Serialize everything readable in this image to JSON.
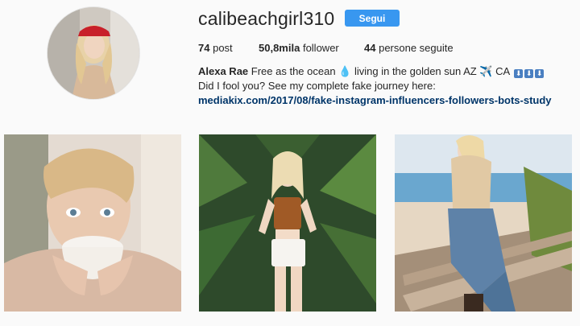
{
  "profile": {
    "username": "calibeachgirl310",
    "follow_label": "Segui",
    "avatar_icon": "profile-photo",
    "stats": {
      "posts_value": "74",
      "posts_label": "post",
      "followers_value": "50,8mila",
      "followers_label": "follower",
      "following_value": "44",
      "following_label": "persone seguite"
    },
    "bio": {
      "name": "Alexa Rae",
      "line1_text": "Free as the ocean 💧 living in the golden sun AZ ✈️ CA",
      "line1_arrows": "⬇",
      "line2_text": "Did I fool you? See my complete fake journey here:",
      "link_text": "mediakix.com/2017/08/fake-instagram-influencers-followers-bots-study"
    }
  },
  "grid": {
    "posts": [
      {
        "icon": "post-photo-coffee"
      },
      {
        "icon": "post-photo-palms"
      },
      {
        "icon": "post-photo-beach"
      }
    ]
  },
  "colors": {
    "accent": "#3897f0",
    "link": "#003569",
    "background": "#fafafa",
    "text": "#262626"
  }
}
